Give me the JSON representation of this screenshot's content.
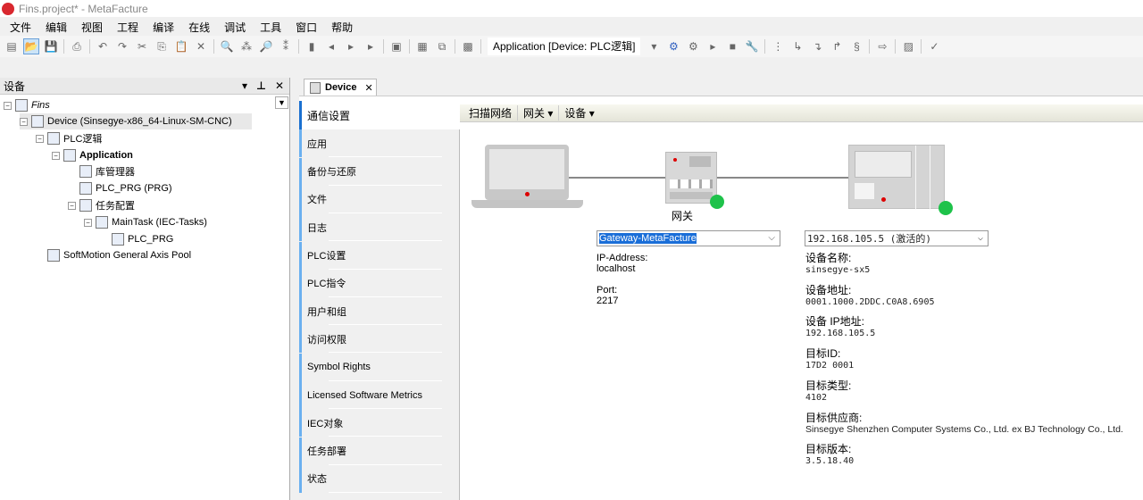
{
  "window": {
    "title": "Fins.project* - MetaFacture"
  },
  "menu": [
    "文件",
    "编辑",
    "视图",
    "工程",
    "编译",
    "在线",
    "调试",
    "工具",
    "窗口",
    "帮助"
  ],
  "toolbar": {
    "active_app": "Application [Device: PLC逻辑]"
  },
  "left_panel": {
    "title": "设备",
    "tree": [
      {
        "label": "Fins",
        "icon": "project-icon",
        "expand": "⊟",
        "italic": true
      },
      {
        "label": "Device (Sinsegye-x86_64-Linux-SM-CNC)",
        "icon": "device-icon",
        "expand": "⊟",
        "selected": true
      },
      {
        "label": "PLC逻辑",
        "icon": "plc-logic-icon",
        "expand": "⊟"
      },
      {
        "label": "Application",
        "icon": "gear-icon",
        "expand": "⊟",
        "bold": true
      },
      {
        "label": "库管理器",
        "icon": "library-icon"
      },
      {
        "label": "PLC_PRG (PRG)",
        "icon": "program-icon"
      },
      {
        "label": "任务配置",
        "icon": "task-config-icon",
        "expand": "⊟"
      },
      {
        "label": "MainTask (IEC-Tasks)",
        "icon": "task-icon",
        "expand": "⊟"
      },
      {
        "label": "PLC_PRG",
        "icon": "program-call-icon"
      },
      {
        "label": "SoftMotion General Axis Pool",
        "icon": "axis-pool-icon"
      }
    ]
  },
  "editor": {
    "tab_label": "Device",
    "nav": [
      "通信设置",
      "应用",
      "备份与还原",
      "文件",
      "日志",
      "PLC设置",
      "PLC指令",
      "用户和组",
      "访问权限",
      "Symbol Rights",
      "Licensed Software Metrics",
      "IEC对象",
      "任务部署",
      "状态"
    ],
    "subtoolbar": {
      "scan": "扫描网络",
      "gateway": "网关 ▾",
      "device": "设备 ▾"
    },
    "gateway_label": "网关",
    "gateway_select": "Gateway-MetaFacture",
    "device_select": "192.168.105.5 (激活的)",
    "gateway_info": [
      {
        "k": "IP-Address:",
        "v": "localhost"
      },
      {
        "k": "Port:",
        "v": "2217"
      }
    ],
    "device_info": [
      {
        "k": "设备名称:",
        "v": "sinsegye-sx5"
      },
      {
        "k": "设备地址:",
        "v": "0001.1000.2DDC.C0A8.6905"
      },
      {
        "k": "设备 IP地址:",
        "v": "192.168.105.5"
      },
      {
        "k": "目标ID:",
        "v": "17D2 0001"
      },
      {
        "k": "目标类型:",
        "v": "4102"
      },
      {
        "k": "目标供应商:",
        "v": "Sinsegye Shenzhen Computer Systems Co., Ltd. ex BJ Technology Co., Ltd."
      },
      {
        "k": "目标版本:",
        "v": "3.5.18.40"
      }
    ],
    "status_color": "#1ec24a"
  }
}
